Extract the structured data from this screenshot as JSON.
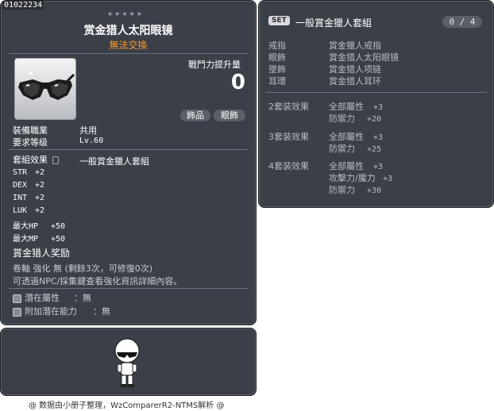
{
  "item": {
    "id": "01022234",
    "stars": 5,
    "name": "赏金猎人太阳眼镜",
    "trade": "無法交換",
    "power_label": "戰鬥力提升量",
    "power_value": "0",
    "tags": [
      "飾品",
      "眼飾"
    ],
    "job_label": "裝備職業",
    "job_value": "共用",
    "level_label": "要求等级",
    "level_value": "Lv.60",
    "setfx_label": "套組效果",
    "setfx_value": "一般賞金獵人套組",
    "stats": [
      {
        "label": "STR",
        "value": "+2"
      },
      {
        "label": "DEX",
        "value": "+2"
      },
      {
        "label": "INT",
        "value": "+2"
      },
      {
        "label": "LUK",
        "value": "+2"
      },
      {
        "label": "最大HP",
        "value": "+50"
      },
      {
        "label": "最大MP",
        "value": "+50"
      }
    ],
    "reward": "賞金猎人奖励",
    "scroll_line": "卷軸 強化 無 (剩餘3次，可修復0次)",
    "scroll_hint": "可透過NPC/採集鍵查看強化資訊詳細內容。",
    "potential_label": "潛在屬性",
    "potential_value": "無",
    "bonus_label": "附加潛在能力",
    "bonus_value": "無"
  },
  "set": {
    "badge": "SET",
    "title": "一般賞金獵人套組",
    "count": "0 / 4",
    "parts": [
      {
        "slot": "戒指",
        "name": "賞金獵人戒指"
      },
      {
        "slot": "眼飾",
        "name": "賞金猎人太阳眼镜"
      },
      {
        "slot": "墜飾",
        "name": "賞金猎人项链"
      },
      {
        "slot": "耳環",
        "name": "賞金猎人耳环"
      }
    ],
    "effects": [
      {
        "label": "2套装效果",
        "lines": [
          {
            "k": "全部屬性",
            "v": "+3"
          },
          {
            "k": "防禦力",
            "v": "+20"
          }
        ]
      },
      {
        "label": "3套装效果",
        "lines": [
          {
            "k": "全部屬性",
            "v": "+3"
          },
          {
            "k": "防禦力",
            "v": "+25"
          }
        ]
      },
      {
        "label": "4套装效果",
        "lines": [
          {
            "k": "全部屬性",
            "v": "+3"
          },
          {
            "k": "攻擊力/魔力",
            "v": "+3"
          },
          {
            "k": "防禦力",
            "v": "+30"
          }
        ]
      }
    ]
  },
  "footer": "@ 数据由小册子整理，WzComparerR2-NTMS解析 @"
}
